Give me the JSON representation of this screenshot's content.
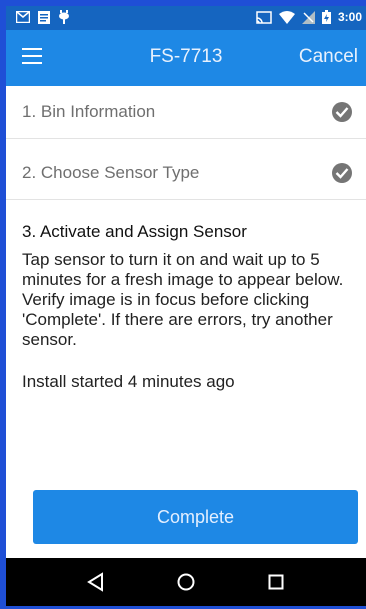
{
  "status_bar": {
    "time": "3:00",
    "icons": [
      "gmail-icon",
      "document-icon",
      "android-debug-icon",
      "cast-icon",
      "wifi-icon",
      "signal-icon",
      "battery-icon"
    ]
  },
  "app_bar": {
    "menu_icon": "hamburger-menu-icon",
    "title": "FS-7713",
    "cancel_label": "Cancel"
  },
  "steps": [
    {
      "label": "1. Bin Information",
      "completed": true
    },
    {
      "label": "2. Choose Sensor Type",
      "completed": true
    }
  ],
  "active_step": {
    "title": "3. Activate and Assign Sensor",
    "instructions": "Tap sensor to turn it on and wait up to 5 minutes for a fresh image to appear below. Verify image is in focus before clicking 'Complete'. If there are errors, try another sensor.",
    "install_status": "Install started 4 minutes ago"
  },
  "complete_label": "Complete",
  "navigation_bar": {
    "buttons": [
      "back-triangle-icon",
      "home-circle-icon",
      "recents-square-icon"
    ]
  },
  "colors": {
    "status_bar": "#1565c0",
    "app_bar": "#1e88e5",
    "button": "#1e88e5",
    "check": "#757575",
    "frame_border": "#1f4fd6"
  }
}
